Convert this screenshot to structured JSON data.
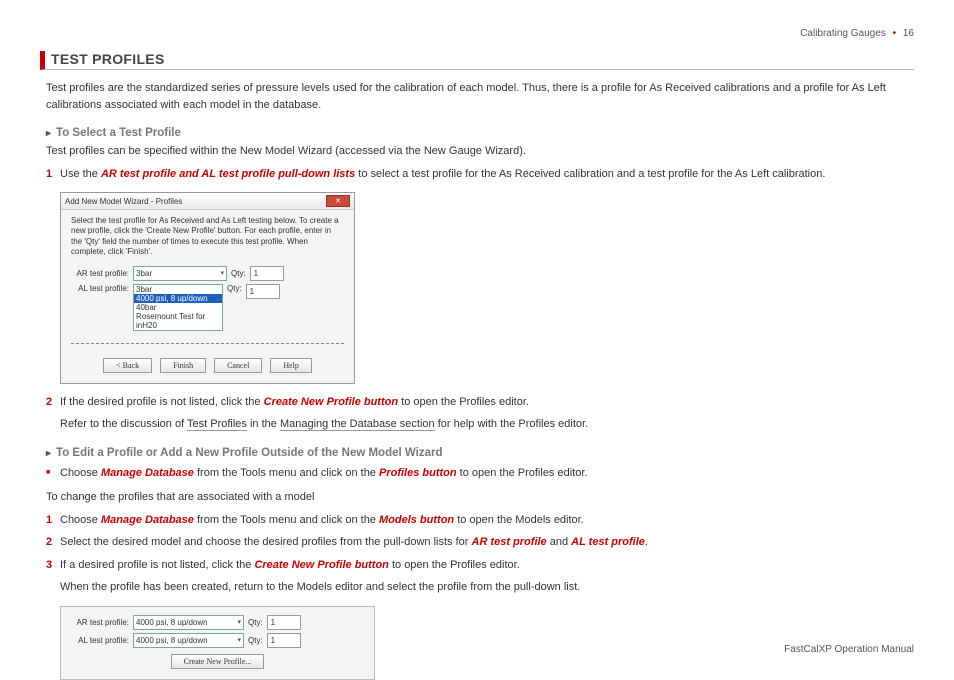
{
  "header": {
    "section": "Calibrating Gauges",
    "page": "16"
  },
  "title": "TEST PROFILES",
  "intro": "Test profiles are the standardized series of pressure levels used for the calibration of each model. Thus, there is a profile for As Received calibrations and a profile for As Left calibrations associated with each model in the database.",
  "s1": {
    "heading": "To Select a Test Profile",
    "lead": "Test profiles can be specified within the New Model Wizard (accessed via the New Gauge Wizard).",
    "n1a": "Use the ",
    "n1b": "AR test profile and AL test profile pull-down lists",
    "n1c": " to select a test profile for the As Received calibration and a test profile for the As Left calibration.",
    "n2a": "If the desired profile is not listed, click the ",
    "n2b": "Create New Profile button",
    "n2c": " to open the Profiles editor.",
    "refer_a": "Refer to the discussion of ",
    "refer_link1": "Test Profiles",
    "refer_b": " in the ",
    "refer_link2": "Managing the Database section",
    "refer_c": " for help with the Profiles editor."
  },
  "dialog": {
    "title": "Add New Model Wizard - Profiles",
    "desc": "Select the test profile for As Received and As Left testing below. To create a new profile, click the 'Create New Profile' button. For each profile, enter in the 'Qty' field the number of times to execute this test profile. When complete, click 'Finish'.",
    "ar_label": "AR test profile:",
    "al_label": "AL test profile:",
    "ar_value": "3bar",
    "qty_label": "Qty:",
    "qty_val": "1",
    "opts": {
      "o1": "3bar",
      "o2": "4000 psi, 8 up/down",
      "o3": "40bar",
      "o4": "Rosemount Test for inH20"
    },
    "btn_back": "< Back",
    "btn_finish": "Finish",
    "btn_cancel": "Cancel",
    "btn_help": "Help"
  },
  "s2": {
    "heading": "To Edit a Profile or Add a New Profile Outside of the New Model Wizard",
    "b1a": "Choose ",
    "b1b": "Manage Database",
    "b1c": " from the Tools menu and click on the ",
    "b1d": "Profiles button",
    "b1e": " to open the Profiles editor.",
    "lead2": "To change the profiles that are associated with a model",
    "n1a": "Choose ",
    "n1b": "Manage Database",
    "n1c": " from the Tools menu and click on the ",
    "n1d": "Models button",
    "n1e": " to open the Models editor.",
    "n2a": "Select the desired model and choose the desired profiles from the pull-down lists for ",
    "n2b": "AR test profile",
    "n2c": " and ",
    "n2d": "AL test profile",
    "n2e": ".",
    "n3a": "If a desired profile is not listed, click the ",
    "n3b": "Create New Profile button",
    "n3c": " to open the Profiles editor.",
    "after": "When the profile has been created, return to the Models editor and select the profile from the pull-down list."
  },
  "panel2": {
    "ar_label": "AR test profile:",
    "al_label": "AL test profile:",
    "value": "4000 psi, 8 up/down",
    "qty_label": "Qty:",
    "qty_val": "1",
    "btn": "Create New Profile..."
  },
  "footer": "FastCalXP Operation Manual"
}
